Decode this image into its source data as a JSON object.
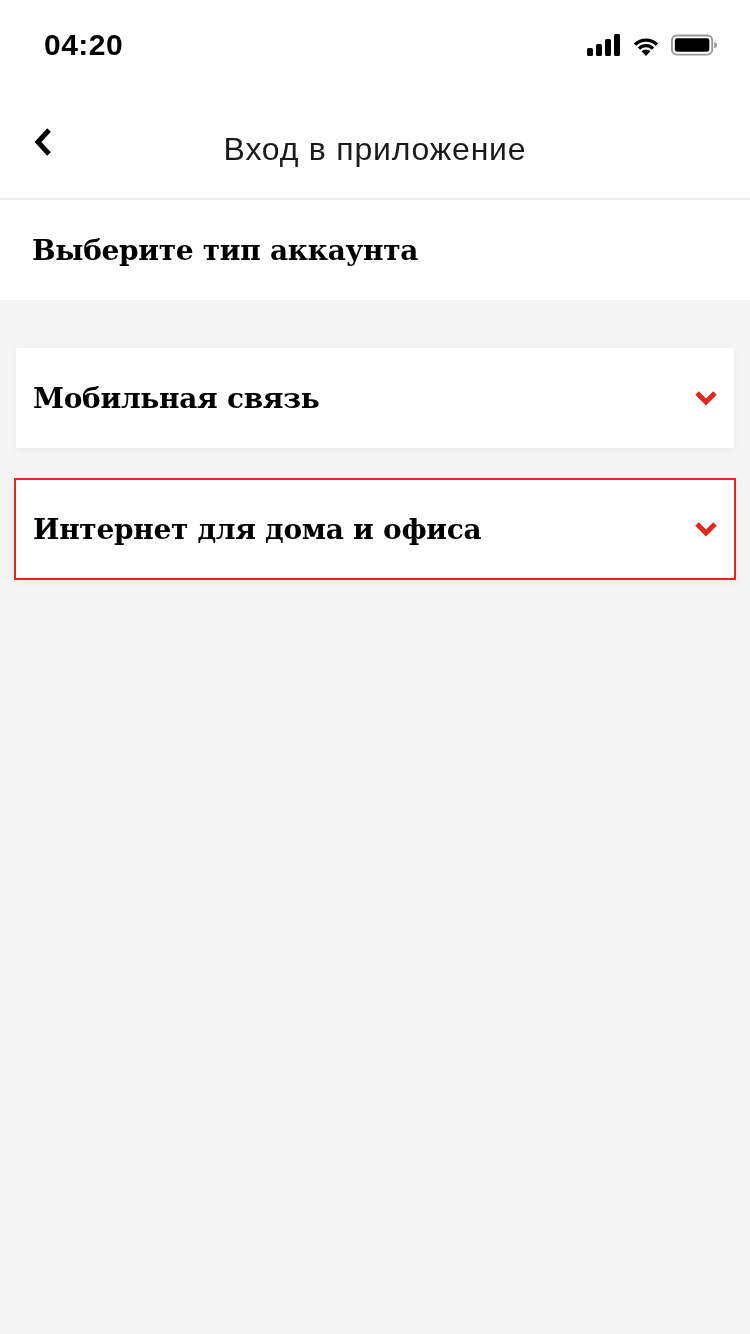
{
  "status_bar": {
    "time": "04:20"
  },
  "nav_bar": {
    "title": "Вход в приложение"
  },
  "section": {
    "title": "Выберите тип аккаунта"
  },
  "account_types": [
    {
      "label": "Мобильная связь",
      "selected": false
    },
    {
      "label": "Интернет для дома и офиса",
      "selected": true
    }
  ]
}
